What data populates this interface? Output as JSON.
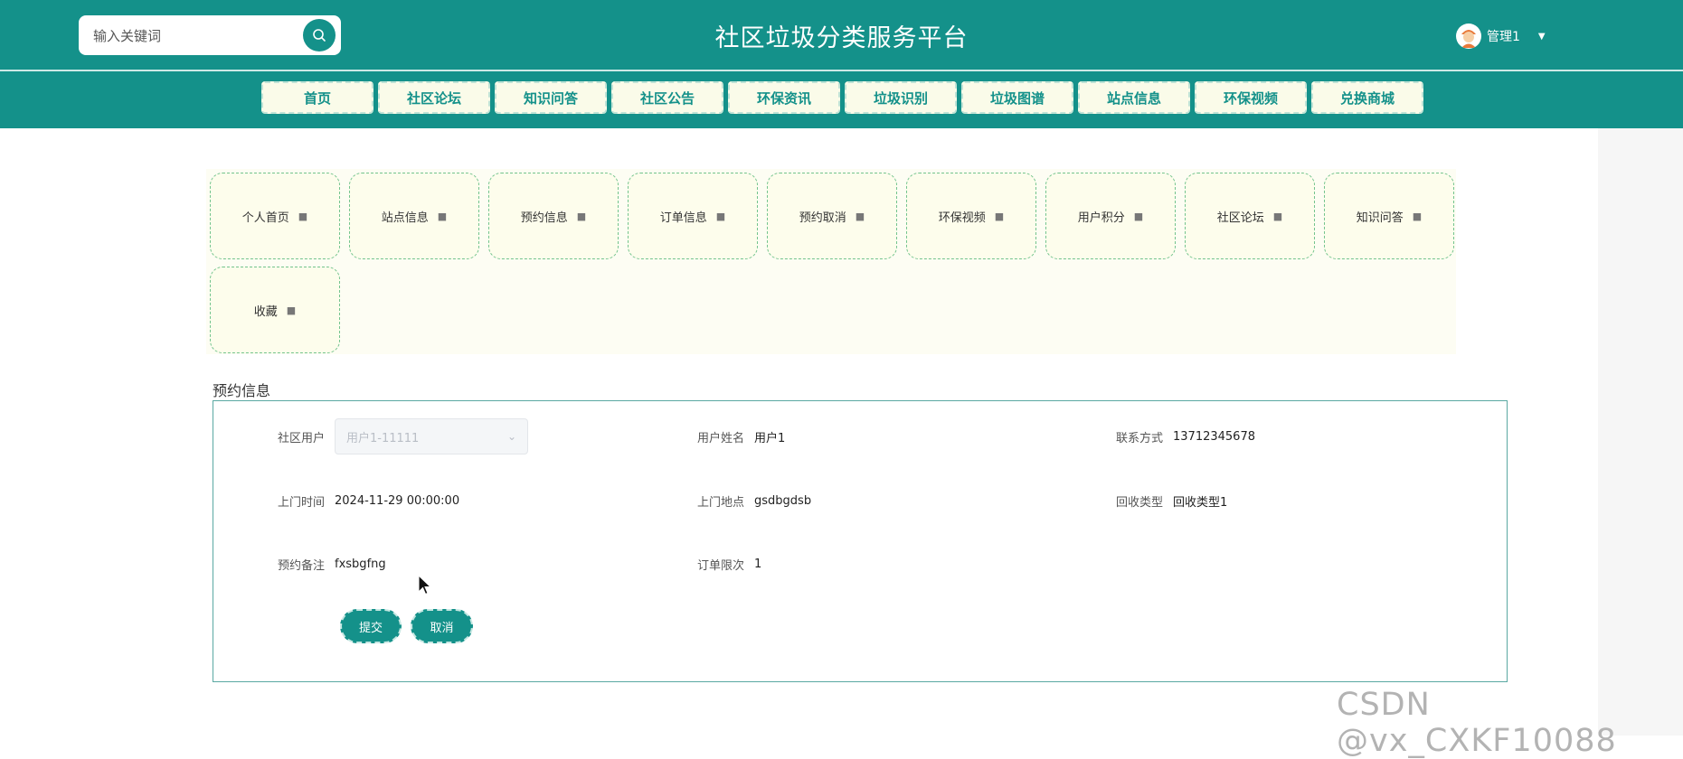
{
  "header": {
    "search_placeholder": "输入关键词",
    "site_title": "社区垃圾分类服务平台",
    "user_name": "管理1"
  },
  "nav": [
    {
      "label": "首页"
    },
    {
      "label": "社区论坛"
    },
    {
      "label": "知识问答"
    },
    {
      "label": "社区公告"
    },
    {
      "label": "环保资讯"
    },
    {
      "label": "垃圾识别"
    },
    {
      "label": "垃圾图谱"
    },
    {
      "label": "站点信息"
    },
    {
      "label": "环保视频"
    },
    {
      "label": "兑换商城"
    }
  ],
  "menu": [
    {
      "label": "个人首页"
    },
    {
      "label": "站点信息"
    },
    {
      "label": "预约信息"
    },
    {
      "label": "订单信息"
    },
    {
      "label": "预约取消"
    },
    {
      "label": "环保视频"
    },
    {
      "label": "用户积分"
    },
    {
      "label": "社区论坛"
    },
    {
      "label": "知识问答"
    },
    {
      "label": "收藏"
    }
  ],
  "form": {
    "section_title": "预约信息",
    "community_user": {
      "label": "社区用户",
      "value": "用户1-11111"
    },
    "user_name": {
      "label": "用户姓名",
      "value": "用户1"
    },
    "contact": {
      "label": "联系方式",
      "value": "13712345678"
    },
    "visit_time": {
      "label": "上门时间",
      "value": "2024-11-29 00:00:00"
    },
    "visit_address": {
      "label": "上门地点",
      "value": "gsdbgdsb"
    },
    "recycle_type": {
      "label": "回收类型",
      "value": "回收类型1"
    },
    "remark": {
      "label": "预约备注",
      "value": "fxsbgfng"
    },
    "order_limit": {
      "label": "订单限次",
      "value": "1"
    },
    "submit_label": "提交",
    "cancel_label": "取消"
  },
  "watermark": "CSDN @vx_CXKF10088",
  "colors": {
    "primary": "#14918a",
    "nav_bg": "#fafbe9",
    "card_border": "#73c48d"
  },
  "icons": {
    "search": "search-icon",
    "avatar": "avatar-icon",
    "menu_item": "small-icon",
    "select": "chevron-down-icon"
  }
}
